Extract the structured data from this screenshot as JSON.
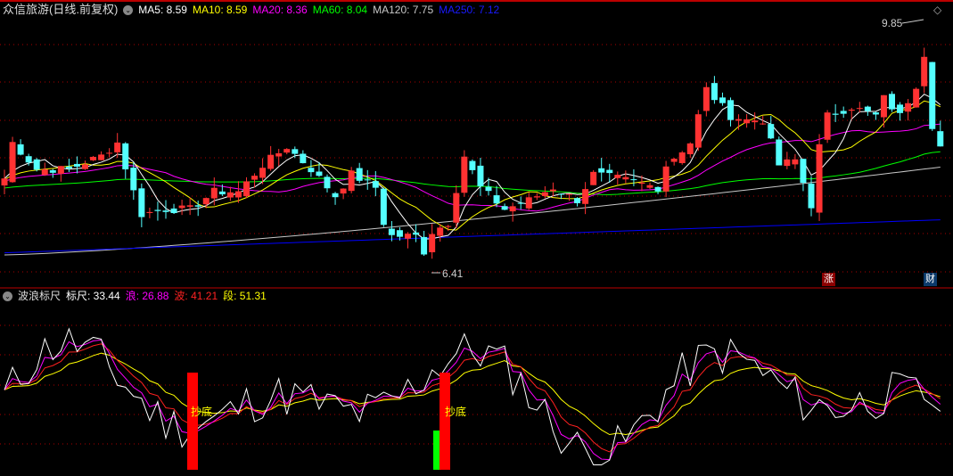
{
  "header": {
    "title": "众信旅游(日线.前复权)",
    "ma": [
      {
        "label": "MA5: 8.59",
        "color": "#ffffff"
      },
      {
        "label": "MA10: 8.59",
        "color": "#ffff00"
      },
      {
        "label": "MA20: 8.36",
        "color": "#ff00ff"
      },
      {
        "label": "MA60: 8.04",
        "color": "#00ff00"
      },
      {
        "label": "MA120: 7.75",
        "color": "#c8c8c8"
      },
      {
        "label": "MA250: 7.12",
        "color": "#0000ff"
      }
    ]
  },
  "indicator": {
    "title": "波浪标尺",
    "items": [
      {
        "label": "标尺: 33.44",
        "color": "#ffffff"
      },
      {
        "label": "浪: 26.88",
        "color": "#ff00ff"
      },
      {
        "label": "波: 41.21",
        "color": "#ff2020"
      },
      {
        "label": "段: 51.31",
        "color": "#ffff00"
      }
    ],
    "signal_label": "抄底",
    "signals_day": [
      23,
      54
    ]
  },
  "annotations": {
    "high": "9.85",
    "low": "6.41",
    "tag_zhang": "涨",
    "tag_cai": "财"
  },
  "chart_data": {
    "type": "candlestick",
    "price_range": [
      6.41,
      9.85
    ],
    "close_keypoints": [
      [
        0,
        7.59
      ],
      [
        1,
        8.1
      ],
      [
        4,
        7.72
      ],
      [
        8,
        7.72
      ],
      [
        12,
        7.91
      ],
      [
        14,
        8.1
      ],
      [
        16,
        7.4
      ],
      [
        17,
        7.08
      ],
      [
        20,
        7.15
      ],
      [
        23,
        7.15
      ],
      [
        26,
        7.4
      ],
      [
        29,
        7.4
      ],
      [
        32,
        7.78
      ],
      [
        35,
        8.04
      ],
      [
        38,
        7.72
      ],
      [
        41,
        7.34
      ],
      [
        43,
        7.65
      ],
      [
        46,
        7.46
      ],
      [
        47,
        6.96
      ],
      [
        48,
        6.77
      ],
      [
        51,
        6.77
      ],
      [
        52,
        6.55
      ],
      [
        53,
        6.83
      ],
      [
        55,
        6.96
      ],
      [
        57,
        7.91
      ],
      [
        59,
        7.46
      ],
      [
        62,
        7.15
      ],
      [
        65,
        7.28
      ],
      [
        68,
        7.46
      ],
      [
        71,
        7.28
      ],
      [
        73,
        7.65
      ],
      [
        76,
        7.59
      ],
      [
        81,
        7.46
      ],
      [
        82,
        7.78
      ],
      [
        85,
        8.1
      ],
      [
        86,
        8.48
      ],
      [
        87,
        8.86
      ],
      [
        90,
        8.48
      ],
      [
        92,
        8.42
      ],
      [
        94,
        8.42
      ],
      [
        96,
        7.78
      ],
      [
        98,
        7.85
      ],
      [
        100,
        7.21
      ],
      [
        101,
        8.04
      ],
      [
        102,
        8.48
      ],
      [
        105,
        8.61
      ],
      [
        108,
        8.48
      ],
      [
        109,
        8.73
      ],
      [
        111,
        8.48
      ],
      [
        113,
        8.92
      ],
      [
        114,
        9.37
      ],
      [
        115,
        8.35
      ],
      [
        116,
        8.04
      ]
    ],
    "ma120_range": [
      6.5,
      7.75
    ],
    "ma250_range": [
      6.53,
      7.0
    ],
    "colors": {
      "up": "#ff3232",
      "down": "#54ffff"
    }
  }
}
